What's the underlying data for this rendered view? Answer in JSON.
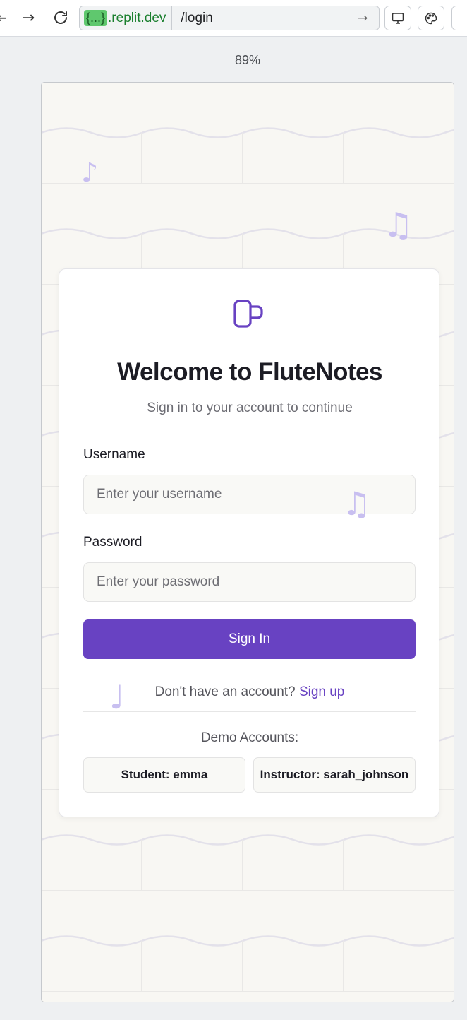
{
  "browser": {
    "url_badge": "{...}",
    "url_domain": ".replit.dev",
    "url_path": "/login",
    "zoom": "89%",
    "icons": [
      "back-arrow-icon",
      "forward-arrow-icon",
      "reload-icon",
      "go-arrow-icon",
      "device-icon",
      "palette-icon"
    ]
  },
  "login": {
    "title": "Welcome to FluteNotes",
    "subtitle": "Sign in to your account to continue",
    "username_label": "Username",
    "username_placeholder": "Enter your username",
    "password_label": "Password",
    "password_placeholder": "Enter your password",
    "signin_label": "Sign In",
    "signup_prompt": "Don't have an account?",
    "signup_link": "Sign up",
    "demo_title": "Demo Accounts:",
    "demo_accounts": [
      "Student: emma",
      "Instructor: sarah_johnson"
    ]
  },
  "colors": {
    "accent": "#6842c2",
    "background": "#f8f7f3",
    "note": "#c8bff0"
  }
}
